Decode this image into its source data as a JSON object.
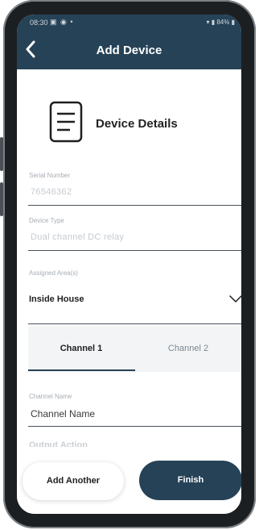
{
  "status_bar": {
    "time": "08:30",
    "battery": "84%"
  },
  "header": {
    "title": "Add Device",
    "back_icon": "chevron-left-icon"
  },
  "section": {
    "title": "Device Details",
    "icon": "document-icon"
  },
  "fields": {
    "serial": {
      "label": "Serial Number",
      "value": "76546362"
    },
    "device_type": {
      "label": "Device Type",
      "value": "Dual channel DC relay"
    },
    "assigned_area": {
      "label": "Assigned Area(s)",
      "value": "Inside House"
    }
  },
  "tabs": [
    {
      "label": "Channel 1",
      "active": true
    },
    {
      "label": "Channel 2",
      "active": false
    }
  ],
  "channel_name": {
    "label": "Channel Name",
    "placeholder": "Channel Name"
  },
  "output_action": {
    "label": "Output Action"
  },
  "buttons": {
    "add_another": "Add Another",
    "finish": "Finish"
  },
  "colors": {
    "primary": "#264257",
    "divider": "#47505a"
  }
}
